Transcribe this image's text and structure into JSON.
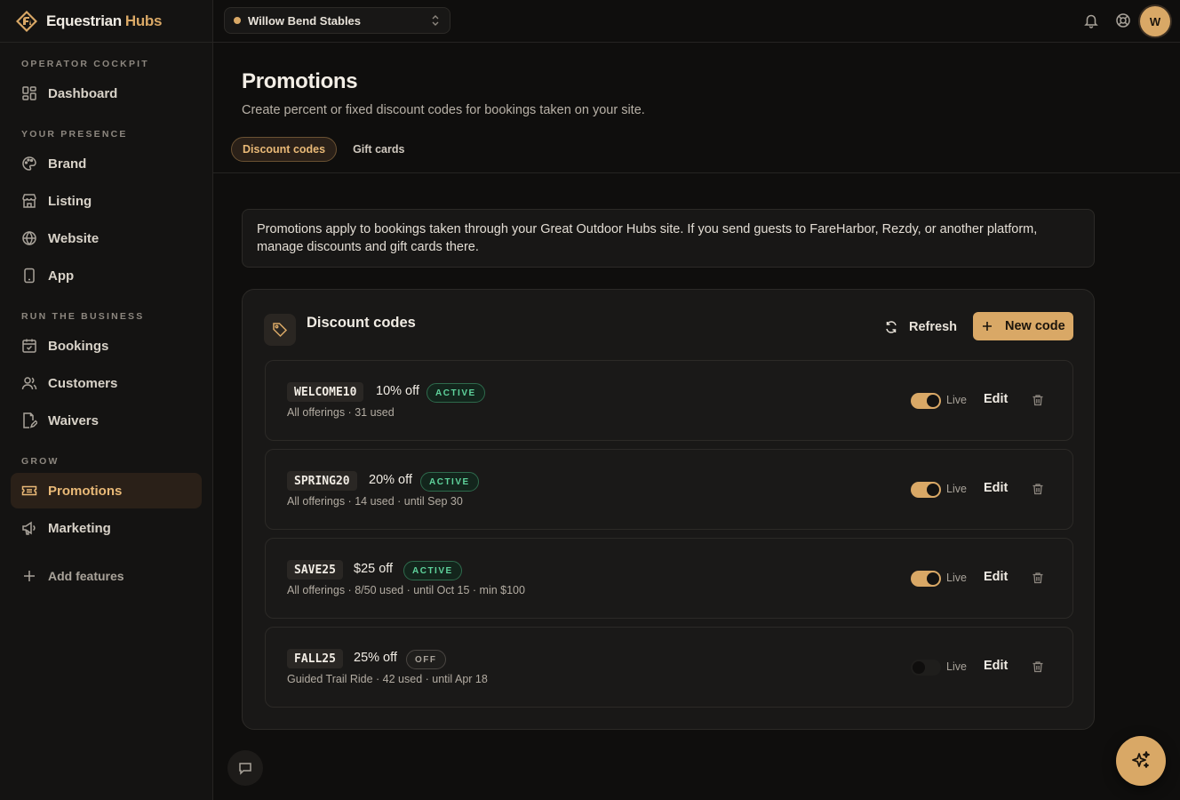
{
  "brand": {
    "name_part1": "Equestrian",
    "name_part2": "Hubs"
  },
  "topbar": {
    "site_name": "Willow Bend Stables",
    "avatar_initial": "W"
  },
  "sidebar": {
    "sections": {
      "cockpit": "OPERATOR COCKPIT",
      "presence": "YOUR PRESENCE",
      "business": "RUN THE BUSINESS",
      "grow": "GROW"
    },
    "items": {
      "dashboard": "Dashboard",
      "brand": "Brand",
      "listing": "Listing",
      "website": "Website",
      "app": "App",
      "bookings": "Bookings",
      "customers": "Customers",
      "waivers": "Waivers",
      "promotions": "Promotions",
      "marketing": "Marketing",
      "add_features": "Add features"
    }
  },
  "page": {
    "title": "Promotions",
    "subtitle": "Create percent or fixed discount codes for bookings taken on your site.",
    "tabs": {
      "discount": "Discount codes",
      "gift": "Gift cards"
    },
    "banner_line1": "Promotions apply to bookings taken through your Great Outdoor Hubs site. If you send guests to FareHarbor, Rezdy, or another platform,",
    "banner_line2": "manage discounts and gift cards there."
  },
  "panel": {
    "title": "Discount codes",
    "refresh_label": "Refresh",
    "new_label": "New code",
    "live_label": "Live",
    "edit_label": "Edit",
    "codes": [
      {
        "code": "WELCOME10",
        "amount": "10% off",
        "status": "ACTIVE",
        "meta": "All offerings · 31 used",
        "live": true
      },
      {
        "code": "SPRING20",
        "amount": "20% off",
        "status": "ACTIVE",
        "meta": "All offerings · 14 used · until Sep 30",
        "live": true
      },
      {
        "code": "SAVE25",
        "amount": "$25 off",
        "status": "ACTIVE",
        "meta": "All offerings · 8/50 used · until Oct 15 · min $100",
        "live": true
      },
      {
        "code": "FALL25",
        "amount": "25% off",
        "status": "OFF",
        "meta": "Guided Trail Ride · 42 used · until Apr 18",
        "live": false
      }
    ]
  },
  "colors": {
    "accent": "#d9a866",
    "background": "#0f0e0d",
    "active_green": "#5fd39c"
  }
}
